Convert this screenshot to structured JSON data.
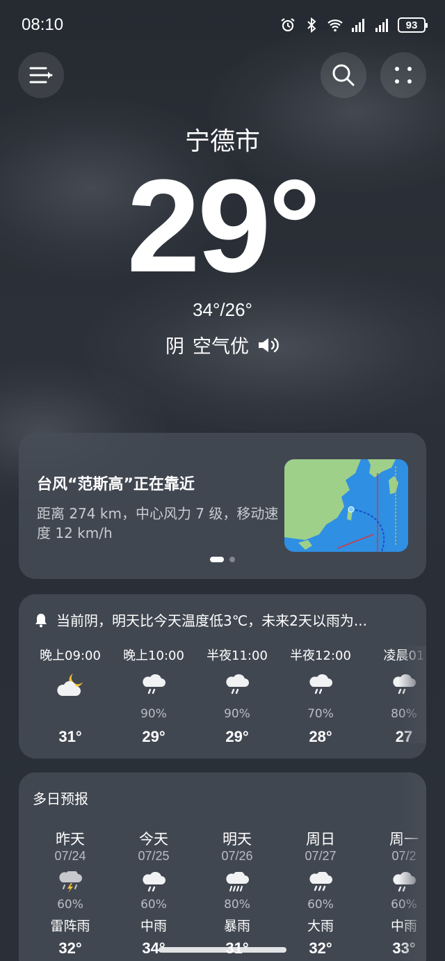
{
  "status_bar": {
    "time": "08:10",
    "battery": "93"
  },
  "location": {
    "city": "宁德市"
  },
  "current": {
    "temperature": "29°",
    "hi_lo": "34°/26°",
    "condition": "阴",
    "air_quality": "空气优"
  },
  "typhoon": {
    "title": "台风“范斯高”正在靠近",
    "description": "距离 274 km，中心风力 7 级，移动速度 12 km/h"
  },
  "hourly": {
    "alert": "当前阴，明天比今天温度低3℃，未来2天以雨为...",
    "items": [
      {
        "time": "晚上09:00",
        "icon": "moon-cloud-icon",
        "pct": "",
        "temp": "31°"
      },
      {
        "time": "晚上10:00",
        "icon": "rain-cloud-icon",
        "pct": "90%",
        "temp": "29°"
      },
      {
        "time": "半夜11:00",
        "icon": "rain-cloud-icon",
        "pct": "90%",
        "temp": "29°"
      },
      {
        "time": "半夜12:00",
        "icon": "rain-cloud-icon",
        "pct": "70%",
        "temp": "28°"
      },
      {
        "time": "凌晨01",
        "icon": "rain-cloud-icon",
        "pct": "80%",
        "temp": "27"
      }
    ]
  },
  "daily": {
    "title": "多日预报",
    "items": [
      {
        "name": "昨天",
        "date": "07/24",
        "icon": "thunderstorm-icon",
        "pct": "60%",
        "desc": "雷阵雨",
        "temp": "32°"
      },
      {
        "name": "今天",
        "date": "07/25",
        "icon": "rain-cloud-icon",
        "pct": "60%",
        "desc": "中雨",
        "temp": "34°"
      },
      {
        "name": "明天",
        "date": "07/26",
        "icon": "heavy-rain-icon",
        "pct": "80%",
        "desc": "暴雨",
        "temp": "31°"
      },
      {
        "name": "周日",
        "date": "07/27",
        "icon": "rain-cloud-icon",
        "pct": "60%",
        "desc": "大雨",
        "temp": "32°"
      },
      {
        "name": "周一",
        "date": "07/2",
        "icon": "rain-cloud-icon",
        "pct": "60%",
        "desc": "中雨",
        "temp": "33°"
      }
    ]
  },
  "colors": {
    "background": "#2a2f37",
    "card": "#484e58",
    "moon": "#f2c230",
    "text_secondary": "#b9bdc4"
  }
}
